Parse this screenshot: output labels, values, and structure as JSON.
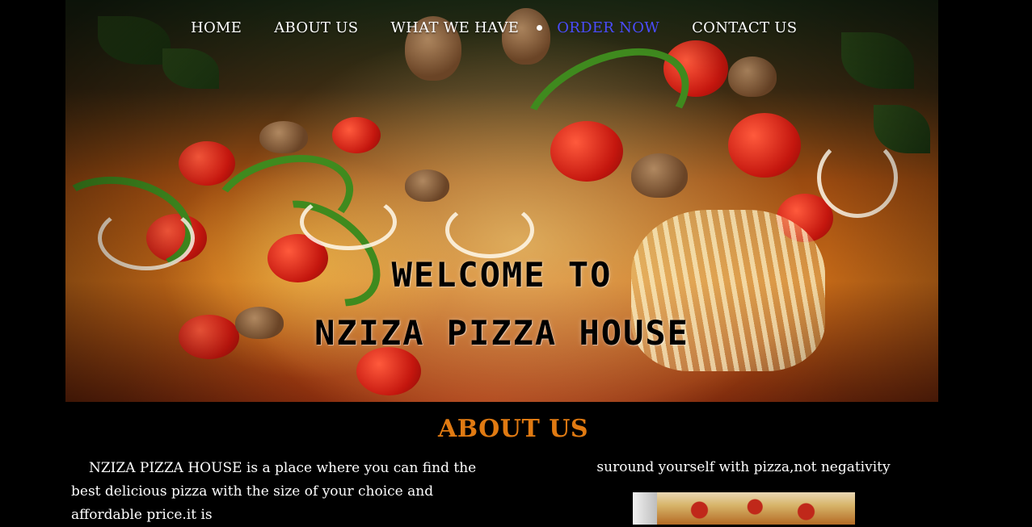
{
  "nav": {
    "items": [
      {
        "label": "HOME"
      },
      {
        "label": "ABOUT US"
      },
      {
        "label": "WHAT WE HAVE"
      },
      {
        "label": "ORDER NOW",
        "active": true
      },
      {
        "label": "CONTACT US"
      }
    ]
  },
  "hero": {
    "title_line1": "WELCOME TO",
    "title_line2": "NZIZA PIZZA HOUSE"
  },
  "about": {
    "heading": "ABOUT US",
    "text": "NZIZA PIZZA HOUSE is a place where you can find the best delicious pizza with the size of your choice and affordable price.it is",
    "slogan": "suround yourself with pizza,not negativity"
  },
  "colors": {
    "background": "#000000",
    "nav_text": "#ffffff",
    "nav_active": "#4a4cff",
    "heading_accent": "#e07a12",
    "body_text": "#ffffff"
  }
}
